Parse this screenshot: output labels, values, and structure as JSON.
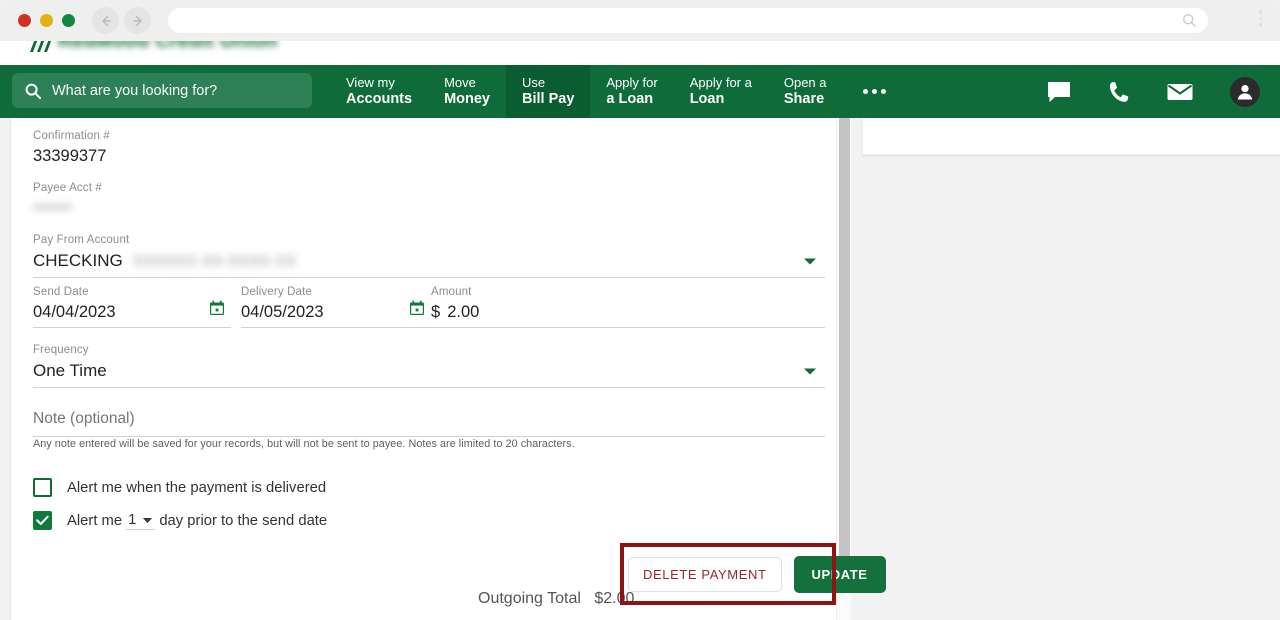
{
  "browser": {
    "traffic_lights": [
      "close-red",
      "minimize-yellow",
      "maximize-green"
    ],
    "back_icon": "back-arrow-icon",
    "forward_icon": "forward-arrow-icon",
    "url_value": "",
    "url_placeholder": "",
    "url_search_icon": "magnifier-icon",
    "menu_icon": "kebab-menu-icon"
  },
  "site_header": {
    "logo_name": "credit-union-logo",
    "logo_text": "Redwood Credit Union"
  },
  "nav": {
    "search": {
      "placeholder": "What are you looking for?",
      "value": "",
      "icon": "search-icon"
    },
    "items": [
      {
        "line1": "View my",
        "line2": "Accounts",
        "active": false
      },
      {
        "line1": "Move",
        "line2": "Money",
        "active": false
      },
      {
        "line1": "Use",
        "line2": "Bill Pay",
        "active": true
      },
      {
        "line1": "Apply for",
        "line2": "a Loan",
        "active": false
      },
      {
        "line1": "Apply for a",
        "line2": "Loan",
        "active": false
      },
      {
        "line1": "Open a",
        "line2": "Share",
        "active": false
      }
    ],
    "more_label": "more-menu",
    "icons": [
      "chat-icon",
      "phone-icon",
      "mail-icon",
      "account-avatar-icon"
    ]
  },
  "form": {
    "confirmation": {
      "label": "Confirmation #",
      "value": "33399377"
    },
    "payee_acct": {
      "label": "Payee Acct #",
      "value": "•••••••",
      "masked": true
    },
    "pay_from": {
      "label": "Pay From Account",
      "value": "CHECKING",
      "masked_suffix": "XXXXXX XX-XXXX XX"
    },
    "send_date": {
      "label": "Send Date",
      "value": "04/04/2023",
      "icon": "calendar-icon"
    },
    "delivery_date": {
      "label": "Delivery Date",
      "value": "04/05/2023",
      "icon": "calendar-icon"
    },
    "amount": {
      "label": "Amount",
      "currency": "$",
      "value": "2.00"
    },
    "frequency": {
      "label": "Frequency",
      "value": "One Time",
      "icon": "chevron-down-icon"
    },
    "note": {
      "label": "Note (optional)",
      "value": "",
      "helper": "Any note entered will be saved for your records, but will not be sent to payee. Notes are limited to 20 characters."
    },
    "alert_delivered": {
      "label": "Alert me when the payment is delivered",
      "checked": false
    },
    "alert_prior": {
      "prefix": "Alert me",
      "days": "1",
      "suffix": "day prior to the send date",
      "checked": true,
      "icon": "chevron-down-icon"
    }
  },
  "footer": {
    "total_label": "Outgoing Total",
    "total_amount": "$2.00"
  },
  "actions": {
    "delete_label": "DELETE PAYMENT",
    "update_label": "UPDATE"
  },
  "scrollbar": {
    "down_arrow_icon": "scroll-down-arrow-icon"
  },
  "colors": {
    "brand_green": "#0f6b3a",
    "active_green": "#0a5c31",
    "button_green": "#15713c",
    "delete_red": "#9b2431",
    "annotation_red": "#8c1414"
  }
}
